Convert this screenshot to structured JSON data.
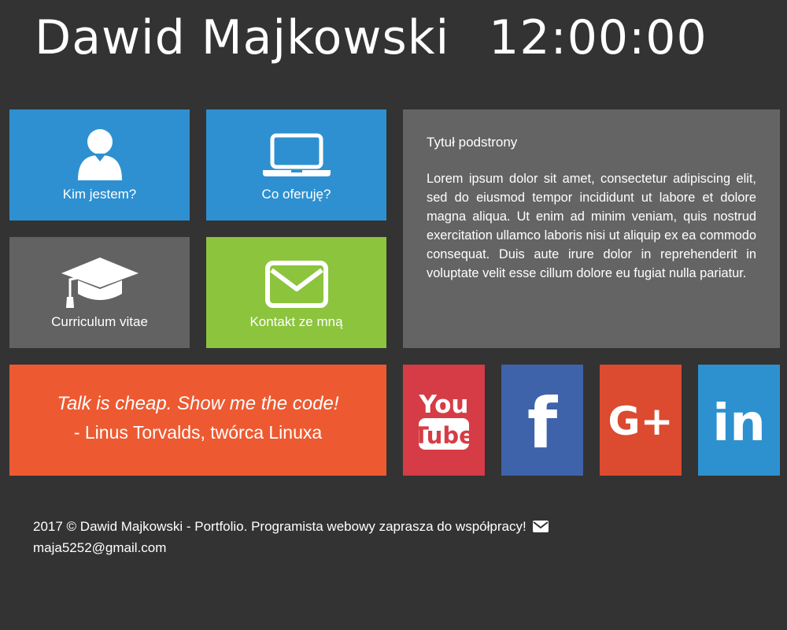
{
  "header": {
    "name": "Dawid Majkowski",
    "clock": "12:00:00"
  },
  "tiles": [
    {
      "label": "Kim jestem?",
      "icon": "user-icon",
      "color": "#2e90d0"
    },
    {
      "label": "Co oferuję?",
      "icon": "laptop-icon",
      "color": "#2e90d0"
    },
    {
      "label": "Curriculum vitae",
      "icon": "graduation-cap-icon",
      "color": "#626262"
    },
    {
      "label": "Kontakt ze mną",
      "icon": "envelope-icon",
      "color": "#8cc43d"
    }
  ],
  "content": {
    "title": "Tytuł podstrony",
    "body": "Lorem ipsum dolor sit amet, consectetur adipiscing elit, sed do eiusmod tempor incididunt ut labore et dolore magna aliqua. Ut enim ad minim veniam, quis nostrud exercitation ullamco laboris nisi ut aliquip ex ea commodo consequat. Duis aute irure dolor in reprehenderit in voluptate velit esse cillum dolore eu fugiat nulla pariatur."
  },
  "quote": {
    "text": "Talk is cheap. Show me the code!",
    "author": "- Linus Torvalds, twórca Linuxa"
  },
  "social": [
    {
      "name": "youtube",
      "icon": "youtube-icon",
      "color": "#d63c45",
      "label_top": "You",
      "label_bottom": "Tube"
    },
    {
      "name": "facebook",
      "icon": "facebook-icon",
      "color": "#3f63ab",
      "label": "f"
    },
    {
      "name": "google-plus",
      "icon": "google-plus-icon",
      "color": "#dc4a2f",
      "label": "G+"
    },
    {
      "name": "linkedin",
      "icon": "linkedin-icon",
      "color": "#2d91d0",
      "label": "in"
    }
  ],
  "footer": {
    "text": "2017 © Dawid Majkowski - Portfolio. Programista webowy zaprasza do współpracy!",
    "email": "maja5252@gmail.com"
  },
  "colors": {
    "background": "#333333",
    "panel": "#646464"
  }
}
